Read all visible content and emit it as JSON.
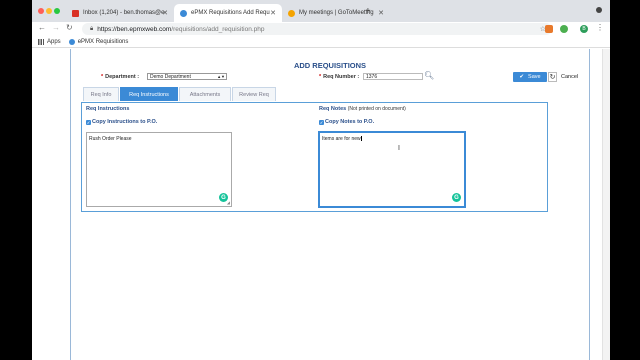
{
  "browser": {
    "tabs": [
      {
        "title": "Inbox (1,204) - ben.thomas@e",
        "favicon_color": "#d93025",
        "active": false
      },
      {
        "title": "ePMX Requisitions Add Requ",
        "favicon_color": "#3b8ad6",
        "active": true
      },
      {
        "title": "My meetings | GoToMeeting",
        "favicon_color": "#f4a300",
        "active": false
      }
    ],
    "url_host": "https://ben.epmxweb.com",
    "url_path": "/requisitions/add_requisition.php",
    "bookmarks": [
      {
        "label": "Apps"
      },
      {
        "label": "ePMX Requisitions"
      }
    ],
    "profile_initial": "B"
  },
  "page": {
    "title": "ADD REQUISITIONS",
    "department_label": "Department :",
    "department_value": "Demo Department",
    "req_number_label": "Req Number :",
    "req_number_value": "1376",
    "save_label": "Save",
    "cancel_label": "Cancel",
    "tabs": [
      {
        "label": "Req Info",
        "active": false
      },
      {
        "label": "Req Instructions",
        "active": true
      },
      {
        "label": "Attachments",
        "active": false
      },
      {
        "label": "Review Req",
        "active": false
      }
    ],
    "instructions": {
      "title": "Req Instructions",
      "checkbox_label": "Copy Instructions to P.O.",
      "text": "Rush Order Please"
    },
    "notes": {
      "title": "Req Notes",
      "subtitle": "(Not printed on document)",
      "checkbox_label": "Copy Notes to P.O.",
      "text": "Items are for new"
    }
  }
}
